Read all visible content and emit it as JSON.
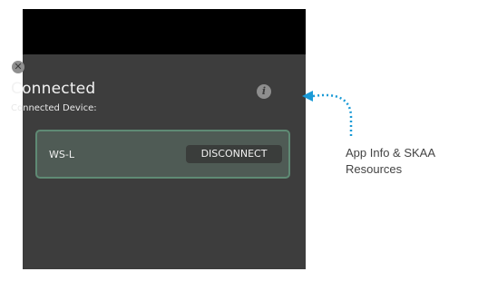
{
  "screen": {
    "status": "Connected",
    "subtitle": "Connected Device:",
    "close_icon": "close-icon",
    "info_icon": "info-icon"
  },
  "device": {
    "name": "WS-L",
    "action_label": "DISCONNECT"
  },
  "annotation": {
    "line1": "App Info & SKAA",
    "line2": "Resources",
    "color": "#1a9ad6"
  }
}
